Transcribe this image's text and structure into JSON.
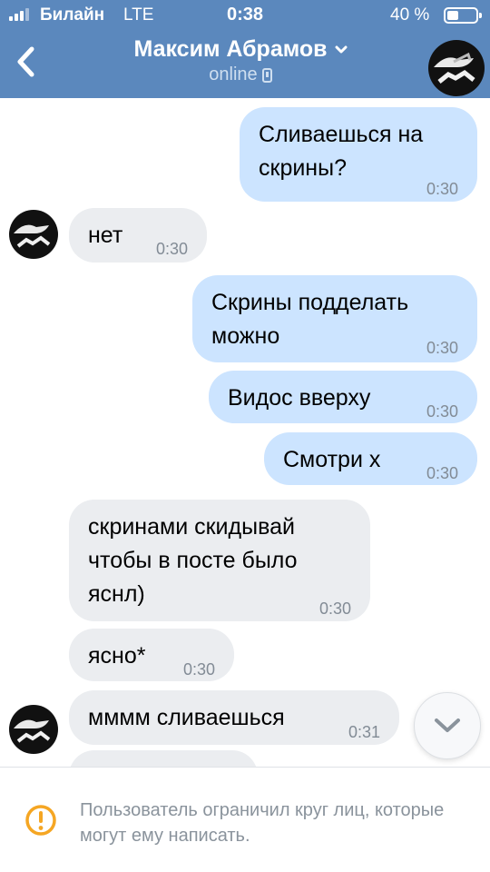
{
  "status_bar": {
    "carrier": "Билайн",
    "network": "LTE",
    "time": "0:38",
    "battery_percent": "40 %",
    "battery_level": 0.4
  },
  "header": {
    "back_icon": "chevron-left-icon",
    "title": "Максим Абрамов",
    "title_dropdown_icon": "chevron-down-icon",
    "subtitle": "online",
    "subtitle_icon": "mobile-phone-icon"
  },
  "messages": [
    {
      "direction": "out",
      "text": "Сливаешься на\nскрины?",
      "time": "0:30"
    },
    {
      "direction": "in",
      "text": "нет",
      "time": "0:30"
    },
    {
      "direction": "out",
      "text": "Скрины подделать\nможно",
      "time": "0:30"
    },
    {
      "direction": "out",
      "text": "Видос вверху",
      "time": "0:30"
    },
    {
      "direction": "out",
      "text": "Смотри х",
      "time": "0:30"
    },
    {
      "direction": "in",
      "text": "скринами скидывай\nчтобы в посте было\nяснл)",
      "time": "0:30"
    },
    {
      "direction": "in",
      "text": "ясно*",
      "time": "0:30"
    },
    {
      "direction": "in",
      "text": "мммм сливаешься",
      "time": "0:31"
    }
  ],
  "scroll_down_icon": "chevron-down-icon",
  "footer": {
    "icon": "warning-icon",
    "text": "Пользователь ограничил круг лиц, которые могут ему написать."
  },
  "colors": {
    "header": "#5b88bd",
    "outgoing_bubble": "#cce4ff",
    "incoming_bubble": "#ebedf0",
    "warning": "#f5a623"
  }
}
